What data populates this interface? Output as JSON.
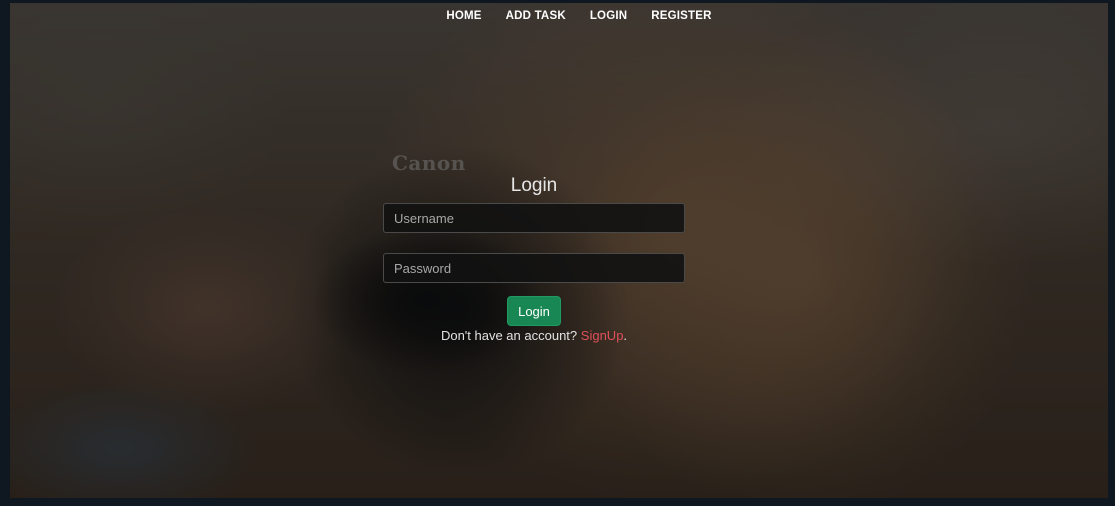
{
  "nav": {
    "items": [
      {
        "label": "HOME"
      },
      {
        "label": "ADD TASK"
      },
      {
        "label": "LOGIN"
      },
      {
        "label": "REGISTER"
      }
    ]
  },
  "background": {
    "camera_brand": "Canon"
  },
  "login_form": {
    "title": "Login",
    "username_placeholder": "Username",
    "password_placeholder": "Password",
    "submit_label": "Login",
    "signup_prompt": "Don't have an account?",
    "signup_link": "SignUp",
    "signup_suffix": "."
  },
  "colors": {
    "button": "#198754",
    "signup_link": "#e0505a",
    "page_border": "#0f1820"
  }
}
